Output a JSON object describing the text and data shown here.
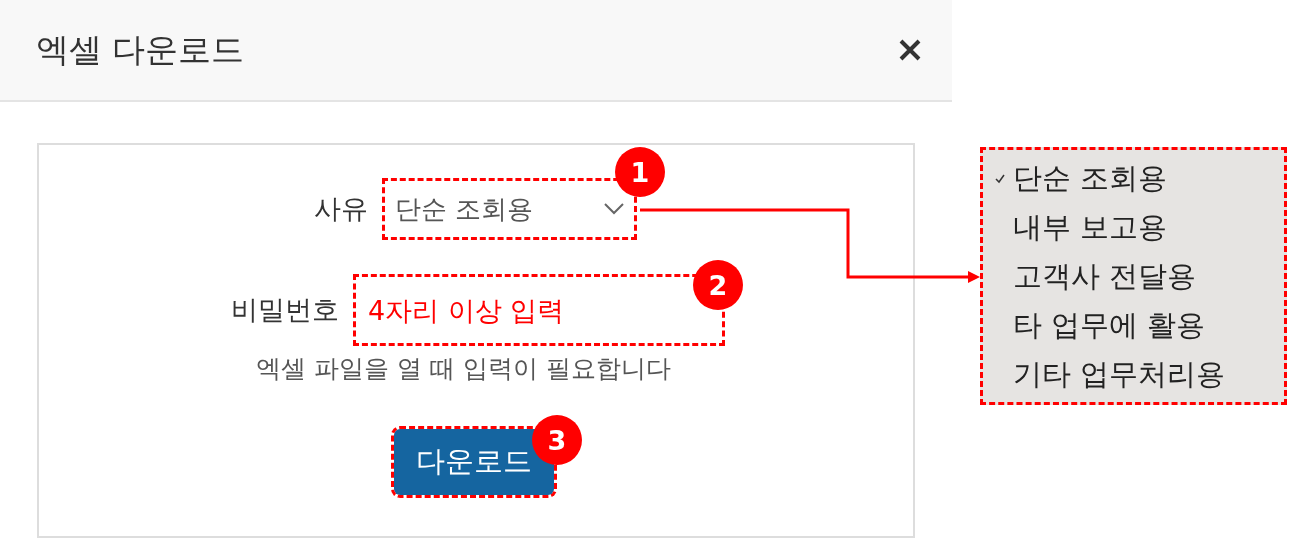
{
  "dialog": {
    "title": "엑셀 다운로드"
  },
  "reason": {
    "label": "사유",
    "value": "단순 조회용",
    "badge": "1"
  },
  "password": {
    "label": "비밀번호",
    "placeholder": "4자리 이상 입력",
    "badge": "2",
    "hint": "엑셀 파일을 열 때 입력이 필요합니다"
  },
  "download_button": {
    "label": "다운로드",
    "badge": "3"
  },
  "dropdown_menu": {
    "items": [
      {
        "label": "단순 조회용",
        "selected": true
      },
      {
        "label": "내부 보고용",
        "selected": false
      },
      {
        "label": "고객사 전달용",
        "selected": false
      },
      {
        "label": "타 업무에 활용",
        "selected": false
      },
      {
        "label": "기타 업무처리용",
        "selected": false
      }
    ]
  }
}
